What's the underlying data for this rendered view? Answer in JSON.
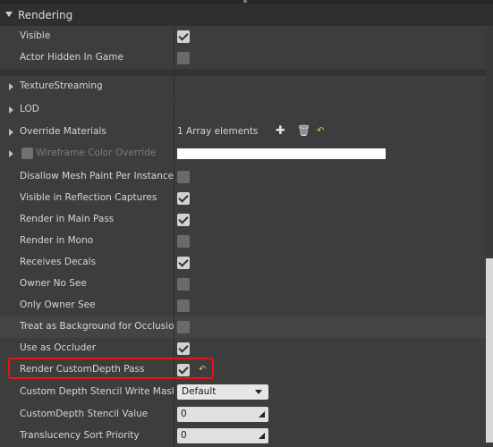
{
  "section": {
    "title": "Rendering"
  },
  "rows_top": [
    {
      "label": "Visible",
      "checked": true
    },
    {
      "label": "Actor Hidden In Game",
      "checked": false
    }
  ],
  "groups": [
    {
      "label": "TextureStreaming"
    },
    {
      "label": "LOD"
    }
  ],
  "override_materials": {
    "label": "Override Materials",
    "value": "1 Array elements"
  },
  "wireframe": {
    "label": "Wireframe Color Override"
  },
  "rows_bool": [
    {
      "label": "Disallow Mesh Paint Per Instance",
      "checked": false
    },
    {
      "label": "Visible in Reflection Captures",
      "checked": true
    },
    {
      "label": "Render in Main Pass",
      "checked": true
    },
    {
      "label": "Render in Mono",
      "checked": false
    },
    {
      "label": "Receives Decals",
      "checked": true
    },
    {
      "label": "Owner No See",
      "checked": false
    },
    {
      "label": "Only Owner See",
      "checked": false
    },
    {
      "label": "Treat as Background for Occlusion",
      "checked": false
    },
    {
      "label": "Use as Occluder",
      "checked": true
    },
    {
      "label": "Render CustomDepth Pass",
      "checked": true
    }
  ],
  "custom_depth_mask": {
    "label": "Custom Depth Stencil Write Mask",
    "value": "Default"
  },
  "custom_depth_value": {
    "label": "CustomDepth Stencil Value",
    "value": "0"
  },
  "translucency": {
    "label": "Translucency Sort Priority",
    "value": "0"
  },
  "colors": {
    "highlight": "#e8141a",
    "reset_arrow": "#e8c84a"
  }
}
